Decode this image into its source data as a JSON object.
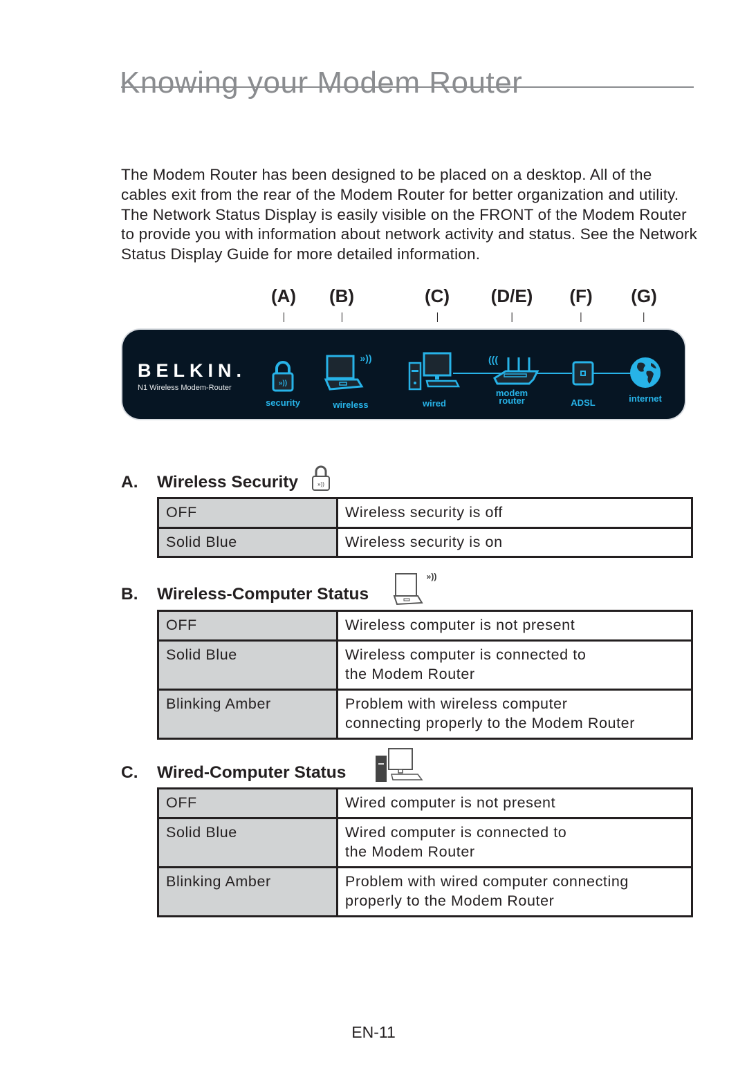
{
  "page": {
    "title": "Knowing your Modem Router",
    "intro": "The Modem Router has been designed to be placed on a desktop. All of the cables exit from the rear of the Modem Router for better organization and utility. The Network Status Display is easily visible on the FRONT of the Modem Router to provide you with information about network activity and status. See the Network Status Display Guide for more detailed information.",
    "page_number": "EN-11"
  },
  "diagram": {
    "callouts": [
      "(A)",
      "(B)",
      "(C)",
      "(D/E)",
      "(F)",
      "(G)"
    ],
    "brand": "BELKIN.",
    "model": "N1 Wireless Modem-Router",
    "accent_color": "#27b3e8",
    "panel_color": "#061523",
    "indicators": [
      {
        "icon": "lock-icon",
        "label": "security"
      },
      {
        "icon": "laptop-icon",
        "label": "wireless"
      },
      {
        "icon": "desktop-computer-icon",
        "label": "wired"
      },
      {
        "icon": "router-icon",
        "label_line1": "modem",
        "label_line2": "router"
      },
      {
        "icon": "adsl-port-icon",
        "label": "ADSL"
      },
      {
        "icon": "globe-icon",
        "label": "internet"
      }
    ]
  },
  "sections": [
    {
      "letter": "A.",
      "title": "Wireless Security",
      "icon": "lock-icon",
      "rows": [
        {
          "state": "OFF",
          "desc": "Wireless security is off"
        },
        {
          "state": "Solid Blue",
          "desc": "Wireless security is on"
        }
      ]
    },
    {
      "letter": "B.",
      "title": "Wireless-Computer Status",
      "icon": "laptop-icon",
      "rows": [
        {
          "state": "OFF",
          "desc": "Wireless computer is not present"
        },
        {
          "state": "Solid Blue",
          "desc_line1": "Wireless computer is connected to",
          "desc_line2": "the Modem Router"
        },
        {
          "state": "Blinking Amber",
          "desc_line1": "Problem with wireless computer",
          "desc_line2": "connecting properly to the Modem Router"
        }
      ]
    },
    {
      "letter": "C.",
      "title": "Wired-Computer Status",
      "icon": "desktop-computer-icon",
      "rows": [
        {
          "state": "OFF",
          "desc": "Wired computer is not present"
        },
        {
          "state": "Solid Blue",
          "desc_line1": "Wired computer is connected to",
          "desc_line2": "the Modem Router"
        },
        {
          "state": "Blinking Amber",
          "desc_line1": "Problem with wired computer connecting",
          "desc_line2": "properly to the Modem Router"
        }
      ]
    }
  ]
}
